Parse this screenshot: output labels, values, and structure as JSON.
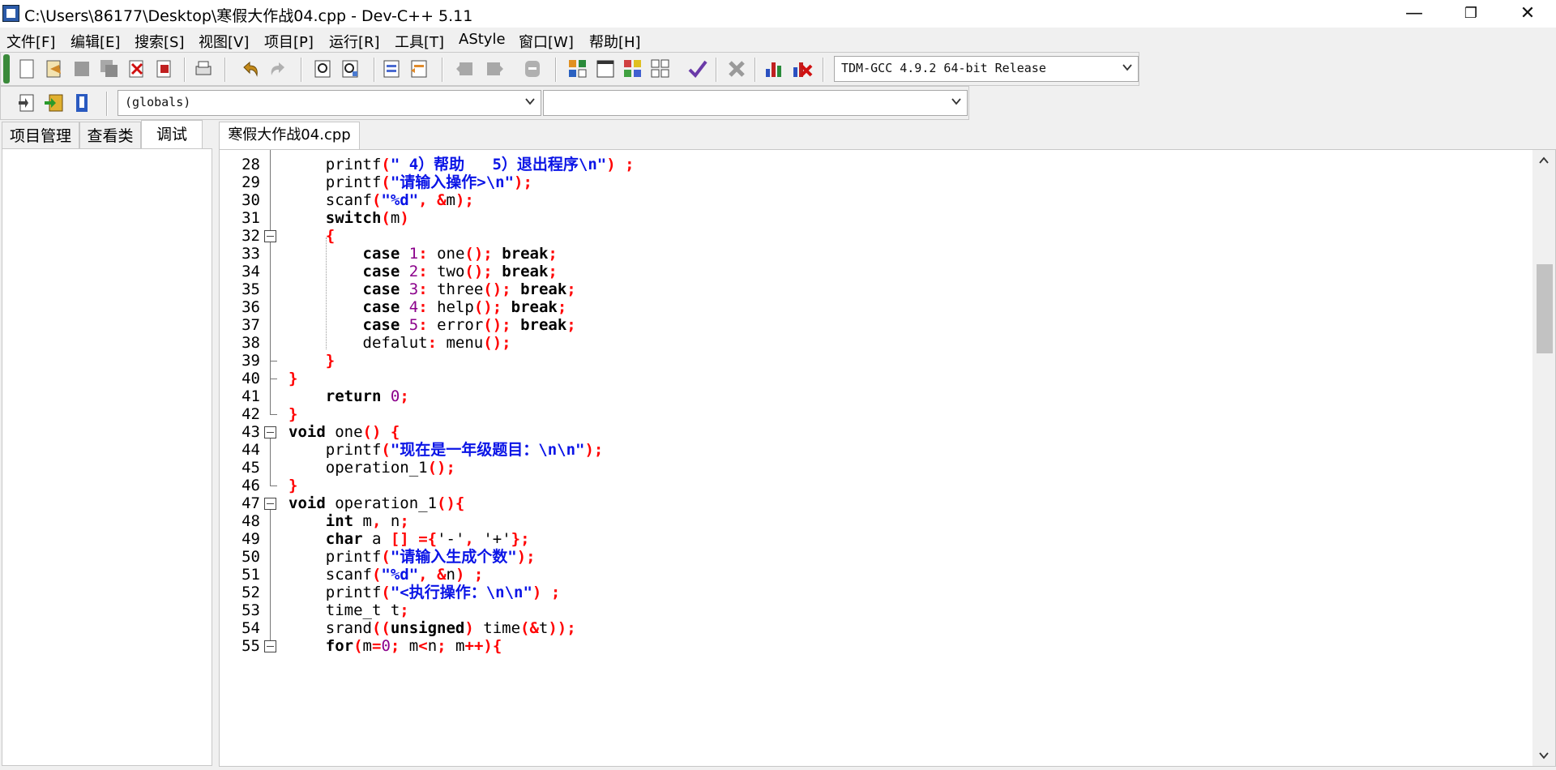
{
  "window": {
    "title": "C:\\Users\\86177\\Desktop\\寒假大作战04.cpp - Dev-C++ 5.11",
    "minimize": "—",
    "restore": "❐",
    "close": "✕"
  },
  "menu": [
    "文件[F]",
    "编辑[E]",
    "搜索[S]",
    "视图[V]",
    "项目[P]",
    "运行[R]",
    "工具[T]",
    "AStyle",
    "窗口[W]",
    "帮助[H]"
  ],
  "toolbar": {
    "compiler": "TDM-GCC 4.9.2 64-bit Release",
    "scope_combo": "(globals)",
    "member_combo": ""
  },
  "left_tabs": [
    "项目管理",
    "查看类",
    "调试"
  ],
  "file_tab": "寒假大作战04.cpp",
  "colors": {
    "keyword": "#000000",
    "string": "#0a14e6",
    "symbol": "#ff0000",
    "number": "#8b008b"
  },
  "code_lines": [
    {
      "n": "28",
      "tokens": [
        [
          "id",
          "    printf"
        ],
        [
          "sym",
          "("
        ],
        [
          "str",
          "\" 4）帮助   5）退出程序\\n\""
        ],
        [
          "sym",
          ")"
        ],
        [
          "id",
          " "
        ],
        [
          "sym",
          ";"
        ]
      ]
    },
    {
      "n": "29",
      "tokens": [
        [
          "id",
          "    printf"
        ],
        [
          "sym",
          "("
        ],
        [
          "str",
          "\"请输入操作>\\n\""
        ],
        [
          "sym",
          ");"
        ]
      ]
    },
    {
      "n": "30",
      "tokens": [
        [
          "id",
          "    scanf"
        ],
        [
          "sym",
          "("
        ],
        [
          "str",
          "\"%d\""
        ],
        [
          "sym",
          ","
        ],
        [
          "id",
          " "
        ],
        [
          "sym",
          "&"
        ],
        [
          "id",
          "m"
        ],
        [
          "sym",
          ");"
        ]
      ]
    },
    {
      "n": "31",
      "tokens": [
        [
          "id",
          "    "
        ],
        [
          "kw",
          "switch"
        ],
        [
          "sym",
          "("
        ],
        [
          "id",
          "m"
        ],
        [
          "sym",
          ")"
        ]
      ]
    },
    {
      "n": "32",
      "tokens": [
        [
          "id",
          "    "
        ],
        [
          "sym",
          "{"
        ]
      ]
    },
    {
      "n": "33",
      "tokens": [
        [
          "id",
          "        "
        ],
        [
          "kw",
          "case"
        ],
        [
          "id",
          " "
        ],
        [
          "num",
          "1"
        ],
        [
          "sym",
          ":"
        ],
        [
          "id",
          " one"
        ],
        [
          "sym",
          "();"
        ],
        [
          "id",
          " "
        ],
        [
          "kw",
          "break"
        ],
        [
          "sym",
          ";"
        ]
      ]
    },
    {
      "n": "34",
      "tokens": [
        [
          "id",
          "        "
        ],
        [
          "kw",
          "case"
        ],
        [
          "id",
          " "
        ],
        [
          "num",
          "2"
        ],
        [
          "sym",
          ":"
        ],
        [
          "id",
          " two"
        ],
        [
          "sym",
          "();"
        ],
        [
          "id",
          " "
        ],
        [
          "kw",
          "break"
        ],
        [
          "sym",
          ";"
        ]
      ]
    },
    {
      "n": "35",
      "tokens": [
        [
          "id",
          "        "
        ],
        [
          "kw",
          "case"
        ],
        [
          "id",
          " "
        ],
        [
          "num",
          "3"
        ],
        [
          "sym",
          ":"
        ],
        [
          "id",
          " three"
        ],
        [
          "sym",
          "();"
        ],
        [
          "id",
          " "
        ],
        [
          "kw",
          "break"
        ],
        [
          "sym",
          ";"
        ]
      ]
    },
    {
      "n": "36",
      "tokens": [
        [
          "id",
          "        "
        ],
        [
          "kw",
          "case"
        ],
        [
          "id",
          " "
        ],
        [
          "num",
          "4"
        ],
        [
          "sym",
          ":"
        ],
        [
          "id",
          " help"
        ],
        [
          "sym",
          "();"
        ],
        [
          "id",
          " "
        ],
        [
          "kw",
          "break"
        ],
        [
          "sym",
          ";"
        ]
      ]
    },
    {
      "n": "37",
      "tokens": [
        [
          "id",
          "        "
        ],
        [
          "kw",
          "case"
        ],
        [
          "id",
          " "
        ],
        [
          "num",
          "5"
        ],
        [
          "sym",
          ":"
        ],
        [
          "id",
          " error"
        ],
        [
          "sym",
          "();"
        ],
        [
          "id",
          " "
        ],
        [
          "kw",
          "break"
        ],
        [
          "sym",
          ";"
        ]
      ]
    },
    {
      "n": "38",
      "tokens": [
        [
          "id",
          "        defalut"
        ],
        [
          "sym",
          ":"
        ],
        [
          "id",
          " menu"
        ],
        [
          "sym",
          "();"
        ]
      ]
    },
    {
      "n": "39",
      "tokens": [
        [
          "id",
          "    "
        ],
        [
          "sym",
          "}"
        ]
      ]
    },
    {
      "n": "40",
      "tokens": [
        [
          "sym",
          "}"
        ]
      ]
    },
    {
      "n": "41",
      "tokens": [
        [
          "id",
          "    "
        ],
        [
          "kw",
          "return"
        ],
        [
          "id",
          " "
        ],
        [
          "num",
          "0"
        ],
        [
          "sym",
          ";"
        ]
      ]
    },
    {
      "n": "42",
      "tokens": [
        [
          "sym",
          "}"
        ]
      ]
    },
    {
      "n": "43",
      "tokens": [
        [
          "kw",
          "void"
        ],
        [
          "id",
          " one"
        ],
        [
          "sym",
          "()"
        ],
        [
          "id",
          " "
        ],
        [
          "sym",
          "{"
        ]
      ]
    },
    {
      "n": "44",
      "tokens": [
        [
          "id",
          "    printf"
        ],
        [
          "sym",
          "("
        ],
        [
          "str",
          "\"现在是一年级题目：\\n\\n\""
        ],
        [
          "sym",
          ");"
        ]
      ]
    },
    {
      "n": "45",
      "tokens": [
        [
          "id",
          "    operation_1"
        ],
        [
          "sym",
          "();"
        ]
      ]
    },
    {
      "n": "46",
      "tokens": [
        [
          "sym",
          "}"
        ]
      ]
    },
    {
      "n": "47",
      "tokens": [
        [
          "kw",
          "void"
        ],
        [
          "id",
          " operation_1"
        ],
        [
          "sym",
          "(){"
        ]
      ]
    },
    {
      "n": "48",
      "tokens": [
        [
          "id",
          "    "
        ],
        [
          "kw",
          "int"
        ],
        [
          "id",
          " m"
        ],
        [
          "sym",
          ","
        ],
        [
          "id",
          " n"
        ],
        [
          "sym",
          ";"
        ]
      ]
    },
    {
      "n": "49",
      "tokens": [
        [
          "id",
          "    "
        ],
        [
          "kw",
          "char"
        ],
        [
          "id",
          " a "
        ],
        [
          "sym",
          "[]"
        ],
        [
          "id",
          " "
        ],
        [
          "sym",
          "={"
        ],
        [
          "id",
          "'-'"
        ],
        [
          "sym",
          ","
        ],
        [
          "id",
          " '+'"
        ],
        [
          "sym",
          "};"
        ]
      ]
    },
    {
      "n": "50",
      "tokens": [
        [
          "id",
          "    printf"
        ],
        [
          "sym",
          "("
        ],
        [
          "str",
          "\"请输入生成个数\""
        ],
        [
          "sym",
          ");"
        ]
      ]
    },
    {
      "n": "51",
      "tokens": [
        [
          "id",
          "    scanf"
        ],
        [
          "sym",
          "("
        ],
        [
          "str",
          "\"%d\""
        ],
        [
          "sym",
          ","
        ],
        [
          "id",
          " "
        ],
        [
          "sym",
          "&"
        ],
        [
          "id",
          "n"
        ],
        [
          "sym",
          ")"
        ],
        [
          "id",
          " "
        ],
        [
          "sym",
          ";"
        ]
      ]
    },
    {
      "n": "52",
      "tokens": [
        [
          "id",
          "    printf"
        ],
        [
          "sym",
          "("
        ],
        [
          "str",
          "\"<执行操作：\\n\\n\""
        ],
        [
          "sym",
          ")"
        ],
        [
          "id",
          " "
        ],
        [
          "sym",
          ";"
        ]
      ]
    },
    {
      "n": "53",
      "tokens": [
        [
          "id",
          "    time_t t"
        ],
        [
          "sym",
          ";"
        ]
      ]
    },
    {
      "n": "54",
      "tokens": [
        [
          "id",
          "    srand"
        ],
        [
          "sym",
          "(("
        ],
        [
          "kw",
          "unsigned"
        ],
        [
          "sym",
          ")"
        ],
        [
          "id",
          " time"
        ],
        [
          "sym",
          "(&"
        ],
        [
          "id",
          "t"
        ],
        [
          "sym",
          "));"
        ]
      ]
    },
    {
      "n": "55",
      "tokens": [
        [
          "id",
          "    "
        ],
        [
          "kw",
          "for"
        ],
        [
          "sym",
          "("
        ],
        [
          "id",
          "m"
        ],
        [
          "sym",
          "="
        ],
        [
          "num",
          "0"
        ],
        [
          "sym",
          ";"
        ],
        [
          "id",
          " m"
        ],
        [
          "sym",
          "<"
        ],
        [
          "id",
          "n"
        ],
        [
          "sym",
          ";"
        ],
        [
          "id",
          " m"
        ],
        [
          "sym",
          "++){"
        ]
      ]
    }
  ]
}
